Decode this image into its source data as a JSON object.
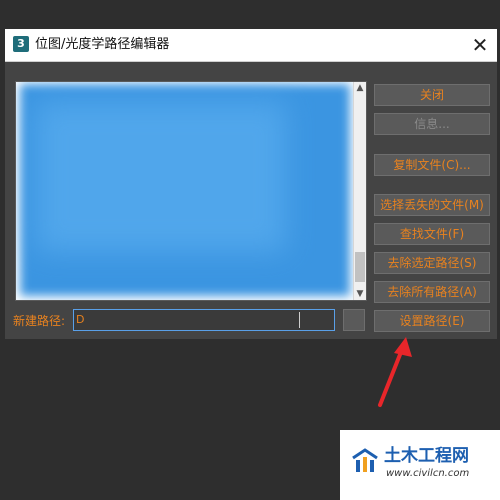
{
  "window": {
    "title": "位图/光度学路径编辑器",
    "app_icon_text": "3"
  },
  "buttons": [
    {
      "label": "关闭",
      "enabled": true
    },
    {
      "label": "信息...",
      "enabled": false
    },
    {
      "label": "复制文件(C)...",
      "enabled": true
    },
    {
      "label": "选择丢失的文件(M)",
      "enabled": true
    },
    {
      "label": "查找文件(F)",
      "enabled": true
    },
    {
      "label": "去除选定路径(S)",
      "enabled": true
    },
    {
      "label": "去除所有路径(A)",
      "enabled": true
    },
    {
      "label": "设置路径(E)",
      "enabled": true
    }
  ],
  "new_path": {
    "label": "新建路径:",
    "value": "D"
  },
  "watermark": {
    "title": "土木工程网",
    "url": "www.civilcn.com"
  },
  "colors": {
    "accent_text": "#e8821f",
    "arrow": "#e8262a",
    "list_blur": "#3b95e1"
  }
}
